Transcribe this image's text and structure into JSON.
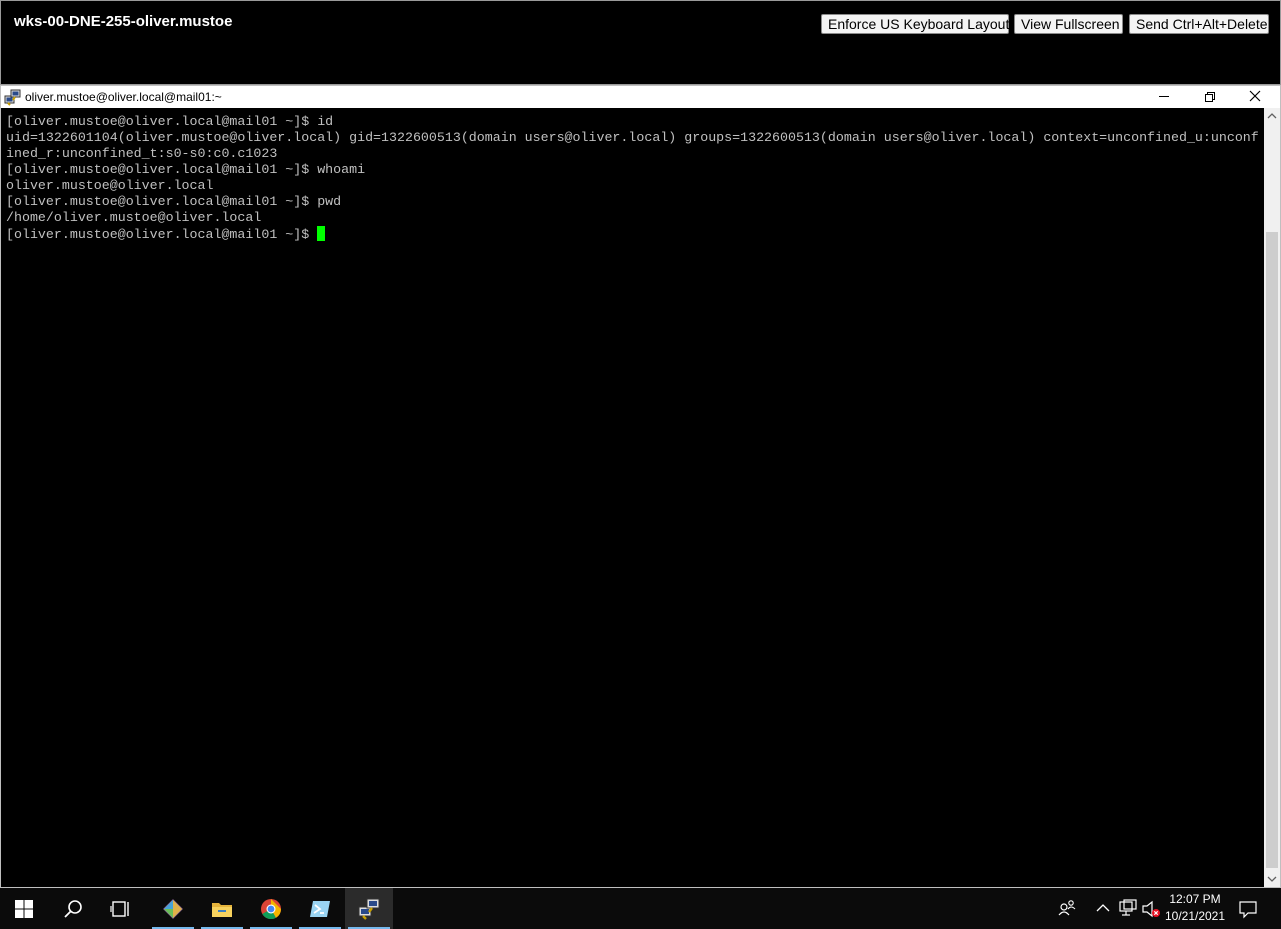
{
  "console": {
    "session_title": "wks-00-DNE-255-oliver.mustoe",
    "buttons": {
      "enforce_keyboard": "Enforce US Keyboard Layout",
      "fullscreen": "View Fullscreen",
      "ctrl_alt_del": "Send Ctrl+Alt+Delete"
    }
  },
  "window": {
    "title": "oliver.mustoe@oliver.local@mail01:~"
  },
  "terminal": {
    "lines": [
      "[oliver.mustoe@oliver.local@mail01 ~]$ id",
      "uid=1322601104(oliver.mustoe@oliver.local) gid=1322600513(domain users@oliver.local) groups=1322600513(domain users@oliver.local) context=unconfined_u:unconf",
      "ined_r:unconfined_t:s0-s0:c0.c1023",
      "[oliver.mustoe@oliver.local@mail01 ~]$ whoami",
      "oliver.mustoe@oliver.local",
      "[oliver.mustoe@oliver.local@mail01 ~]$ pwd",
      "/home/oliver.mustoe@oliver.local",
      "[oliver.mustoe@oliver.local@mail01 ~]$ "
    ],
    "cursor_color": "#00ff00"
  },
  "taskbar": {
    "icons": [
      "windows-start-icon",
      "search-icon",
      "task-view-icon",
      "git-icon",
      "file-explorer-icon",
      "chrome-icon",
      "powershell-icon",
      "putty-icon"
    ],
    "tray_icons": [
      "people-icon",
      "chevron-up-icon",
      "network-icon",
      "volume-muted-icon",
      "notifications-icon"
    ],
    "clock_time": "12:07 PM",
    "clock_date": "10/21/2021"
  }
}
